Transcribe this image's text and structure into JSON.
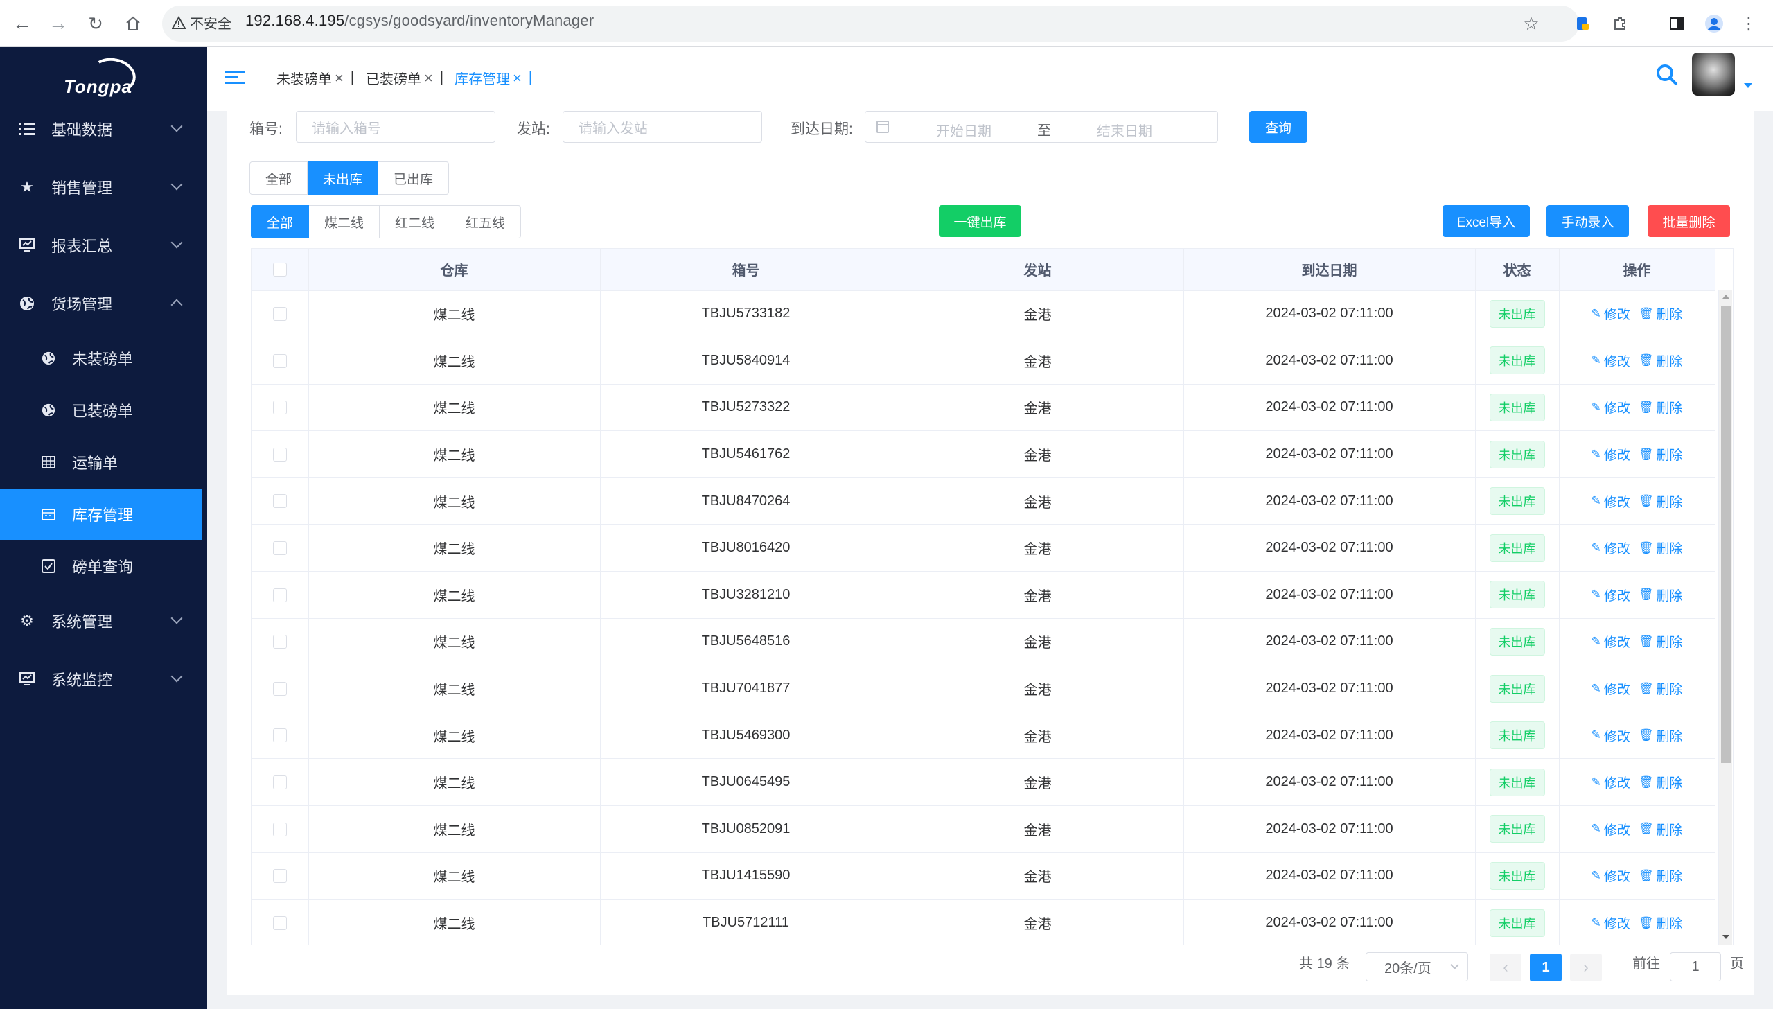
{
  "browser": {
    "insecure_label": "不安全",
    "url_host": "192.168.4.195",
    "url_path": "/cgsys/goodsyard/inventoryManager"
  },
  "logo_text": "Tongpa",
  "sidebar": {
    "items": [
      {
        "label": "基础数据",
        "icon": "list-icon"
      },
      {
        "label": "销售管理",
        "icon": "star-icon"
      },
      {
        "label": "报表汇总",
        "icon": "monitor-icon"
      },
      {
        "label": "货场管理",
        "icon": "globe-icon"
      },
      {
        "label": "系统管理",
        "icon": "gear-icon"
      },
      {
        "label": "系统监控",
        "icon": "monitor-icon"
      }
    ],
    "sub_items": [
      {
        "label": "未装磅单",
        "icon": "globe-icon"
      },
      {
        "label": "已装磅单",
        "icon": "globe-icon"
      },
      {
        "label": "运输单",
        "icon": "table-icon"
      },
      {
        "label": "库存管理",
        "icon": "calendar-icon"
      },
      {
        "label": "磅单查询",
        "icon": "checkbox-icon"
      }
    ]
  },
  "tabs": [
    {
      "label": "未装磅单"
    },
    {
      "label": "已装磅单"
    },
    {
      "label": "库存管理"
    }
  ],
  "filters": {
    "box_label": "箱号:",
    "box_placeholder": "请输入箱号",
    "station_label": "发站:",
    "station_placeholder": "请输入发站",
    "date_label": "到达日期:",
    "start_placeholder": "开始日期",
    "range_sep": "至",
    "end_placeholder": "结束日期",
    "query_button": "查询"
  },
  "status_filter": [
    "全部",
    "未出库",
    "已出库"
  ],
  "line_filter": [
    "全部",
    "煤二线",
    "红二线",
    "红五线"
  ],
  "actions": {
    "one_click_out": "一键出库",
    "excel_import": "Excel导入",
    "manual_entry": "手动录入",
    "batch_delete": "批量删除"
  },
  "table": {
    "headers": [
      "仓库",
      "箱号",
      "发站",
      "到达日期",
      "状态",
      "操作"
    ],
    "edit_label": "修改",
    "delete_label": "删除",
    "rows": [
      {
        "warehouse": "煤二线",
        "box": "TBJU5733182",
        "station": "金港",
        "date": "2024-03-02 07:11:00",
        "status": "未出库"
      },
      {
        "warehouse": "煤二线",
        "box": "TBJU5840914",
        "station": "金港",
        "date": "2024-03-02 07:11:00",
        "status": "未出库"
      },
      {
        "warehouse": "煤二线",
        "box": "TBJU5273322",
        "station": "金港",
        "date": "2024-03-02 07:11:00",
        "status": "未出库"
      },
      {
        "warehouse": "煤二线",
        "box": "TBJU5461762",
        "station": "金港",
        "date": "2024-03-02 07:11:00",
        "status": "未出库"
      },
      {
        "warehouse": "煤二线",
        "box": "TBJU8470264",
        "station": "金港",
        "date": "2024-03-02 07:11:00",
        "status": "未出库"
      },
      {
        "warehouse": "煤二线",
        "box": "TBJU8016420",
        "station": "金港",
        "date": "2024-03-02 07:11:00",
        "status": "未出库"
      },
      {
        "warehouse": "煤二线",
        "box": "TBJU3281210",
        "station": "金港",
        "date": "2024-03-02 07:11:00",
        "status": "未出库"
      },
      {
        "warehouse": "煤二线",
        "box": "TBJU5648516",
        "station": "金港",
        "date": "2024-03-02 07:11:00",
        "status": "未出库"
      },
      {
        "warehouse": "煤二线",
        "box": "TBJU7041877",
        "station": "金港",
        "date": "2024-03-02 07:11:00",
        "status": "未出库"
      },
      {
        "warehouse": "煤二线",
        "box": "TBJU5469300",
        "station": "金港",
        "date": "2024-03-02 07:11:00",
        "status": "未出库"
      },
      {
        "warehouse": "煤二线",
        "box": "TBJU0645495",
        "station": "金港",
        "date": "2024-03-02 07:11:00",
        "status": "未出库"
      },
      {
        "warehouse": "煤二线",
        "box": "TBJU0852091",
        "station": "金港",
        "date": "2024-03-02 07:11:00",
        "status": "未出库"
      },
      {
        "warehouse": "煤二线",
        "box": "TBJU1415590",
        "station": "金港",
        "date": "2024-03-02 07:11:00",
        "status": "未出库"
      },
      {
        "warehouse": "煤二线",
        "box": "TBJU5712111",
        "station": "金港",
        "date": "2024-03-02 07:11:00",
        "status": "未出库"
      }
    ]
  },
  "pagination": {
    "total": "共 19 条",
    "page_size": "20条/页",
    "current_page": "1",
    "goto_label": "前往",
    "goto_value": "1",
    "page_suffix": "页"
  },
  "colors": {
    "primary": "#1890ff",
    "success": "#13ce66",
    "danger": "#ff4d4f",
    "sidebar_bg": "#0d1b3e"
  }
}
